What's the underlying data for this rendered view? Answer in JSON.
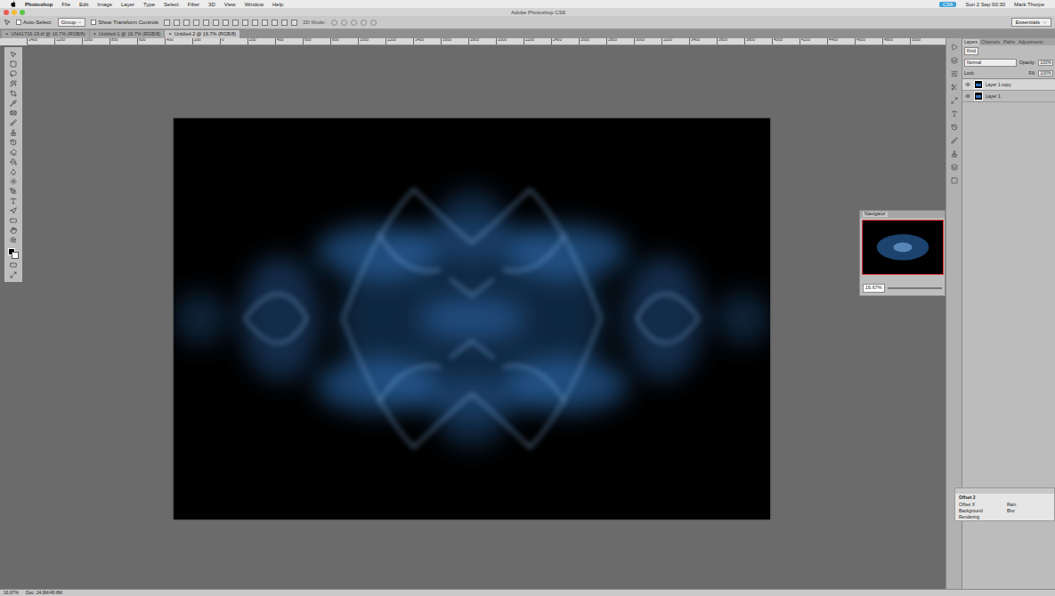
{
  "menu_bar": {
    "items": [
      "Photoshop",
      "File",
      "Edit",
      "Image",
      "Layer",
      "Type",
      "Select",
      "Filter",
      "3D",
      "View",
      "Window",
      "Help"
    ],
    "clock": "Sun 2 Sep 00:30",
    "user": "Mark Thorpe",
    "badge": "CS6"
  },
  "window": {
    "title": "Adobe Photoshop CS6"
  },
  "options_bar": {
    "auto_select": {
      "label": "Auto-Select:",
      "checked": false
    },
    "target": "Group",
    "transform": {
      "label": "Show Transform Controls",
      "checked": false
    },
    "mode_3d": "3D Mode:",
    "workspace": "Essentials"
  },
  "document_tabs": [
    {
      "label": "UNA1716-19.tif @ 16.7% (RGB/8)",
      "selected": false
    },
    {
      "label": "Untitled-1 @ 16.7% (RGB/8)",
      "selected": false
    },
    {
      "label": "Untitled-2 @ 16.7% (RGB/8)",
      "selected": true
    }
  ],
  "tab_close": "×",
  "ruler": [
    "1400",
    "1200",
    "1000",
    "800",
    "600",
    "400",
    "200",
    "0",
    "200",
    "400",
    "600",
    "800",
    "1000",
    "1200",
    "1400",
    "1600",
    "1800",
    "2000",
    "2200",
    "2400",
    "2600",
    "2800",
    "3000",
    "3200",
    "3400",
    "3600",
    "3800",
    "4000",
    "4200",
    "4400",
    "4600",
    "4800",
    "5000"
  ],
  "navigator": {
    "title": "Navigator",
    "zoom": "16.67%"
  },
  "layers_panel": {
    "tabs": [
      {
        "label": "Layers",
        "selected": true
      },
      {
        "label": "Channels",
        "selected": false
      },
      {
        "label": "Paths",
        "selected": false
      },
      {
        "label": "Adjustments",
        "selected": false
      }
    ],
    "filter": "Kind",
    "blend": "Normal",
    "opacity_label": "Opacity:",
    "opacity": "100%",
    "lock_label": "Lock:",
    "fill_label": "Fill:",
    "fill": "100%",
    "layers": [
      {
        "name": "Layer 1 copy",
        "visible": true,
        "selected": true
      },
      {
        "name": "Layer 1",
        "visible": true,
        "selected": false
      }
    ]
  },
  "effect_panel": {
    "title": "Offset 2",
    "rows": [
      {
        "label": "Offset X",
        "value": "Rain"
      },
      {
        "label": "Background",
        "value": "Blur"
      },
      {
        "label": "Rendering",
        "value": ""
      }
    ]
  },
  "status_bar": {
    "zoom": "16.67%",
    "doc": "Doc: 24.9M/49.8M"
  }
}
